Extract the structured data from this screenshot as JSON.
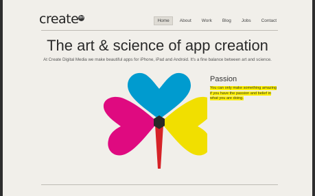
{
  "logo": {
    "text": "create",
    "badge": "dm"
  },
  "nav": {
    "items": [
      {
        "label": "Home",
        "active": true
      },
      {
        "label": "About"
      },
      {
        "label": "Work"
      },
      {
        "label": "Blog"
      },
      {
        "label": "Jobs"
      },
      {
        "label": "Contact"
      }
    ]
  },
  "hero": {
    "title": "The art & science of app creation",
    "tagline": "At Create Digital Media we make beautiful apps for iPhone, iPad and Android. It's a fine balance between art and science."
  },
  "side": {
    "title": "Passion",
    "lines": [
      "You can only make something amazing",
      "if you have the passion and belief in",
      "what you are doing."
    ]
  },
  "colors": {
    "cyan": "#00a6e2",
    "magenta": "#ec0a8c",
    "yellow": "#ffee00",
    "highlight": "#fff200"
  }
}
